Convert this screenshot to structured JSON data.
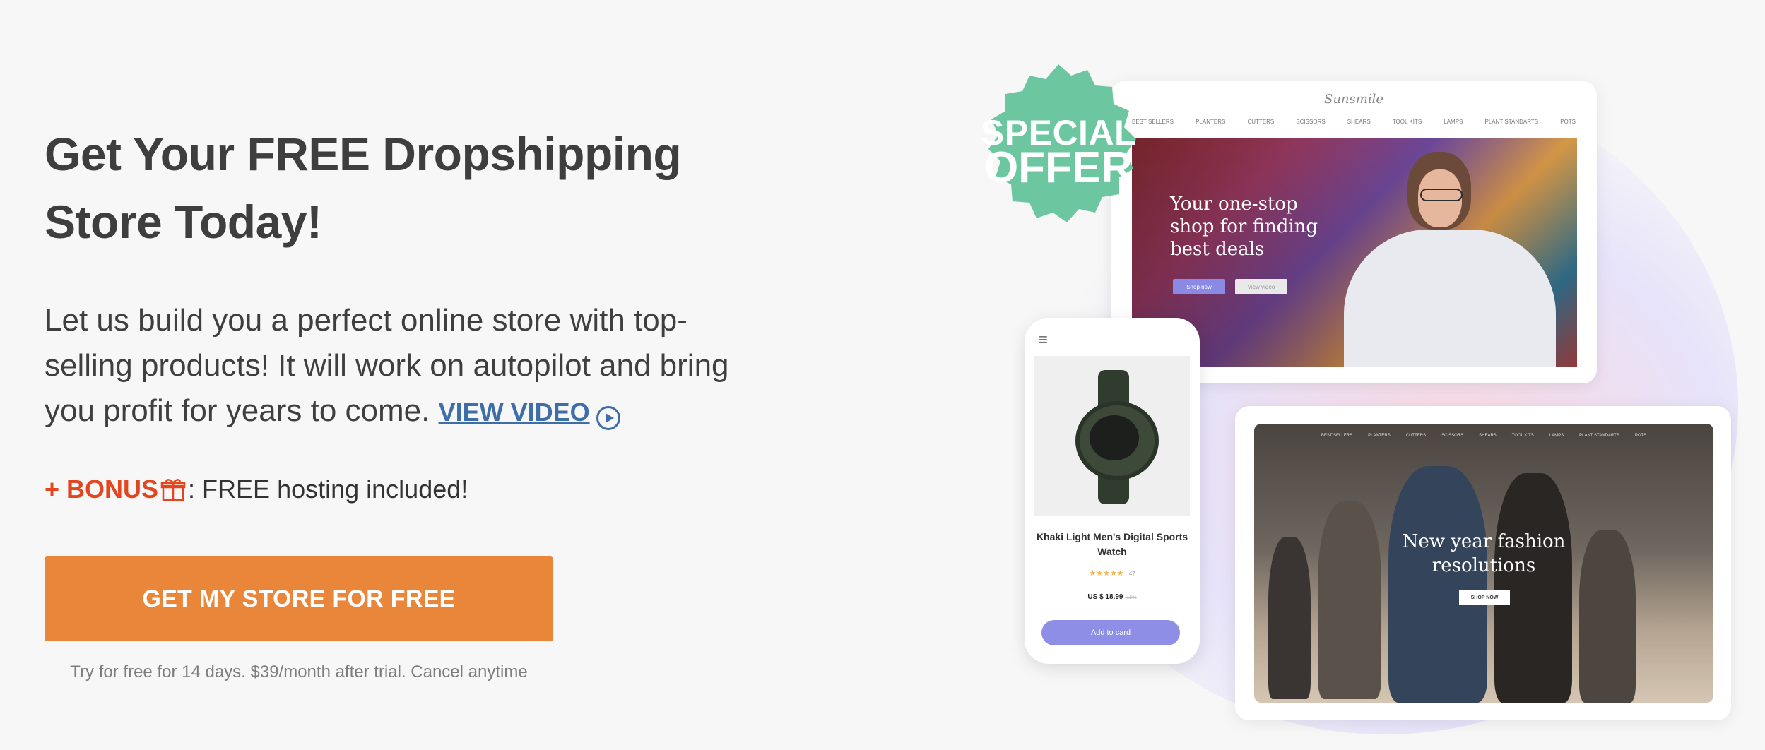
{
  "hero": {
    "headline_line1": "Get Your FREE Dropshipping",
    "headline_line2": "Store Today!",
    "subtext": "Let us build you a perfect online store with top-selling products! It will work on autopilot and bring you profit for years to come.",
    "video_link_label": "VIEW VIDEO",
    "bonus_label": "+ BONUS",
    "bonus_text": ": FREE hosting included!",
    "cta_label": "GET MY STORE FOR FREE",
    "trial_note": "Try for free for 14 days. $39/month after trial. Cancel anytime"
  },
  "icons": {
    "video": "play-circle-icon",
    "bonus": "gift-icon",
    "phone_menu": "hamburger-menu-icon"
  },
  "badge": {
    "line1": "SPECIAL",
    "line2": "OFFER",
    "color": "#6cc7a1"
  },
  "desktop_mock": {
    "brand": "Sunsmile",
    "nav": [
      "BEST SELLERS",
      "PLANTERS",
      "CUTTERS",
      "SCISSORS",
      "SHEARS",
      "TOOL KITS",
      "LAMPS",
      "PLANT STANDARTS",
      "POTS"
    ],
    "headline": "Your one-stop shop for finding best deals",
    "btn_primary": "Shop now",
    "btn_secondary": "View video"
  },
  "phone_mock": {
    "product_name": "Khaki Light Men's Digital Sports Watch",
    "stars": "★★★★★",
    "review_count": "47",
    "price": "US $ 18.99",
    "old_price": "-15%",
    "add_button": "Add to card"
  },
  "beach_mock": {
    "nav": [
      "BEST SELLERS",
      "PLANTERS",
      "CUTTERS",
      "SCISSORS",
      "SHEARS",
      "TOOL KITS",
      "LAMPS",
      "PLANT STANDARTS",
      "POTS"
    ],
    "headline_line1": "New year fashion",
    "headline_line2": "resolutions",
    "button": "SHOP NOW"
  },
  "colors": {
    "cta": "#e9863a",
    "bonus": "#e3461f",
    "link": "#3d6ea8",
    "badge": "#6cc7a1"
  }
}
